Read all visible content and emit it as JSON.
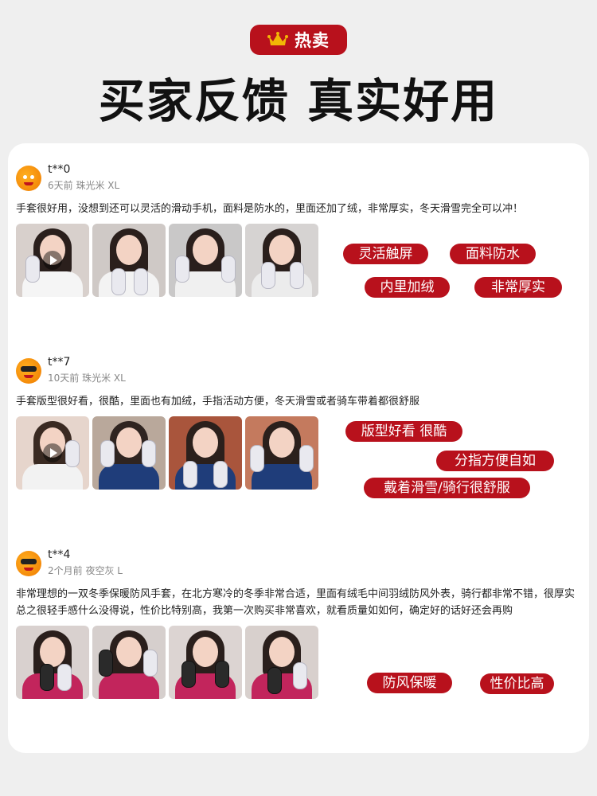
{
  "header": {
    "badge_icon": "crown-icon",
    "badge_text": "热卖",
    "title": "买家反馈 真实好用",
    "accent_color": "#b8111c"
  },
  "reviews": [
    {
      "username": "t**0",
      "meta": "6天前 珠光米 XL",
      "text": "手套很好用，没想到还可以灵活的滑动手机，面料是防水的，里面还加了绒，非常厚实，冬天滑雪完全可以冲！",
      "tags": [
        "灵活触屏",
        "面料防水",
        "内里加绒",
        "非常厚实"
      ]
    },
    {
      "username": "t**7",
      "meta": "10天前 珠光米 XL",
      "text": "手套版型很好看，很酷，里面也有加绒，手指活动方便，冬天滑雪或者骑车带着都很舒服",
      "tags": [
        "版型好看 很酷",
        "分指方便自如",
        "戴着滑雪/骑行很舒服"
      ]
    },
    {
      "username": "t**4",
      "meta": "2个月前 夜空灰 L",
      "text": "非常理想的一双冬季保暖防风手套，在北方寒冷的冬季非常合适，里面有绒毛中间羽绒防风外表，骑行都非常不错，很厚实总之很轻手感什么没得说，性价比特别高，我第一次购买非常喜欢，就看质量如如何，确定好的话好还会再购",
      "tags": [
        "防风保暖",
        "性价比高"
      ]
    }
  ]
}
